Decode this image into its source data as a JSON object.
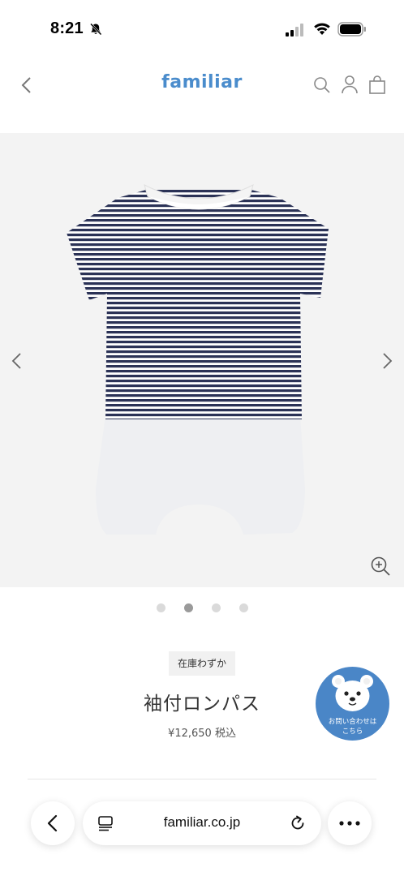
{
  "status_bar": {
    "time": "8:21"
  },
  "header": {
    "brand": "familiar",
    "brand_color": "#4a8ccc"
  },
  "gallery": {
    "image_alt": "striped short-sleeve romper",
    "total_images": 4,
    "active_index": 1
  },
  "product": {
    "stock_badge": "在庫わずか",
    "title": "袖付ロンパス",
    "price": "¥12,650 税込"
  },
  "contact_button": {
    "line1": "お問い合わせは",
    "line2": "こちら",
    "color": "#4a86c7"
  },
  "browser": {
    "url": "familiar.co.jp"
  },
  "icons": [
    "bell-slash-icon",
    "signal-icon",
    "wifi-icon",
    "battery-icon",
    "back-chevron-icon",
    "search-icon",
    "account-icon",
    "bag-icon",
    "chevron-left-icon",
    "chevron-right-icon",
    "zoom-in-icon",
    "reader-icon",
    "reload-icon",
    "more-icon"
  ]
}
